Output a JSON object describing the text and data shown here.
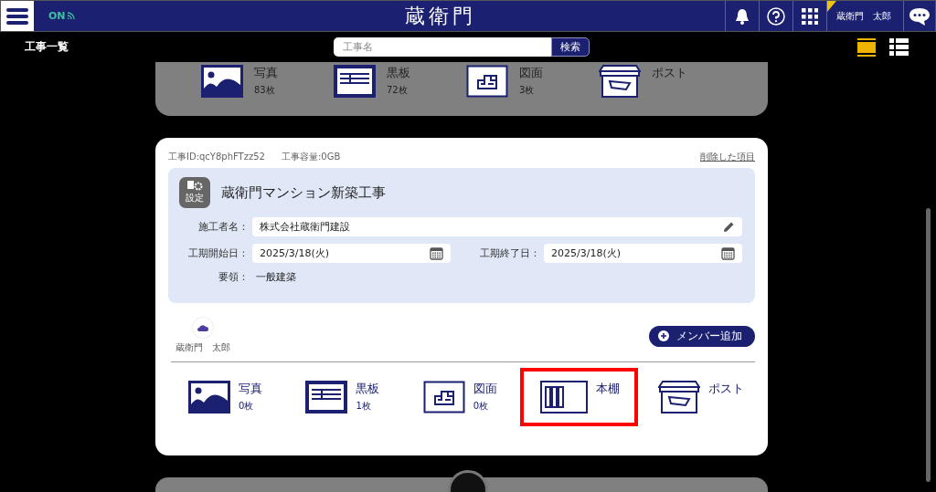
{
  "header": {
    "status": "ON",
    "logo": "蔵衛門",
    "user_name": "蔵衛門　太郎"
  },
  "toolbar": {
    "title": "工事一覧",
    "search": {
      "placeholder": "工事名",
      "button": "検索"
    },
    "view_toggles": [
      {
        "kind": "card",
        "selected": true
      },
      {
        "kind": "list",
        "selected": false
      }
    ]
  },
  "previous_project": {
    "tiles": [
      {
        "kind": "photo",
        "label": "写真",
        "count": "83枚"
      },
      {
        "kind": "board",
        "label": "黒板",
        "count": "72枚"
      },
      {
        "kind": "drawing",
        "label": "図面",
        "count": "3枚"
      },
      {
        "kind": "post",
        "label": "ポスト"
      }
    ]
  },
  "project": {
    "id": "工事ID:qcY8phFTzz52",
    "capacity": "工事容量:0GB",
    "deleted_link": "削除した項目",
    "settings_label": "設定",
    "title": "蔵衛門マンション新築工事",
    "rows": [
      {
        "fields": [
          {
            "kind": "text",
            "label": "施工者名：",
            "value": "株式会社蔵衛門建設"
          }
        ]
      },
      {
        "fields": [
          {
            "kind": "date",
            "label": "工期開始日：",
            "value": "2025/3/18(火)"
          },
          {
            "kind": "date",
            "label": "工期終了日：",
            "value": "2025/3/18(火)"
          }
        ]
      },
      {
        "fields": [
          {
            "kind": "plain",
            "label": "要領：",
            "value": "一般建築"
          }
        ]
      }
    ],
    "members": [
      {
        "name": "蔵衛門　太郎"
      }
    ],
    "add_member_button": "メンバー追加",
    "tiles": [
      {
        "kind": "photo",
        "label": "写真",
        "count": "0枚",
        "highlighted": false
      },
      {
        "kind": "board",
        "label": "黒板",
        "count": "1枚",
        "highlighted": false
      },
      {
        "kind": "drawing",
        "label": "図面",
        "count": "0枚",
        "highlighted": false
      },
      {
        "kind": "shelf",
        "label": "本棚",
        "highlighted": true
      },
      {
        "kind": "post",
        "label": "ポスト",
        "highlighted": false
      }
    ]
  }
}
